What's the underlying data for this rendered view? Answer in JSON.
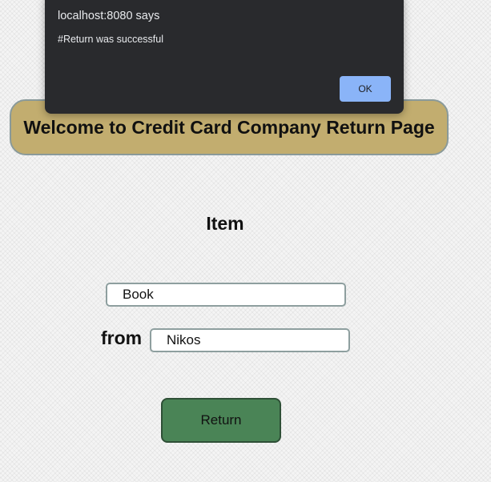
{
  "dialog": {
    "title": "localhost:8080 says",
    "message": "#Return was successful",
    "ok_label": "OK"
  },
  "banner": {
    "title": "Welcome to Credit Card Company Return Page"
  },
  "form": {
    "item_heading": "Item",
    "item_value": "Book",
    "from_label": "from",
    "from_value": "Nikos",
    "return_label": "Return"
  },
  "colors": {
    "banner_bg": "#c2ad6f",
    "button_bg": "#4a8456",
    "dialog_bg": "#292a2d",
    "dialog_button": "#8ab4f8"
  }
}
